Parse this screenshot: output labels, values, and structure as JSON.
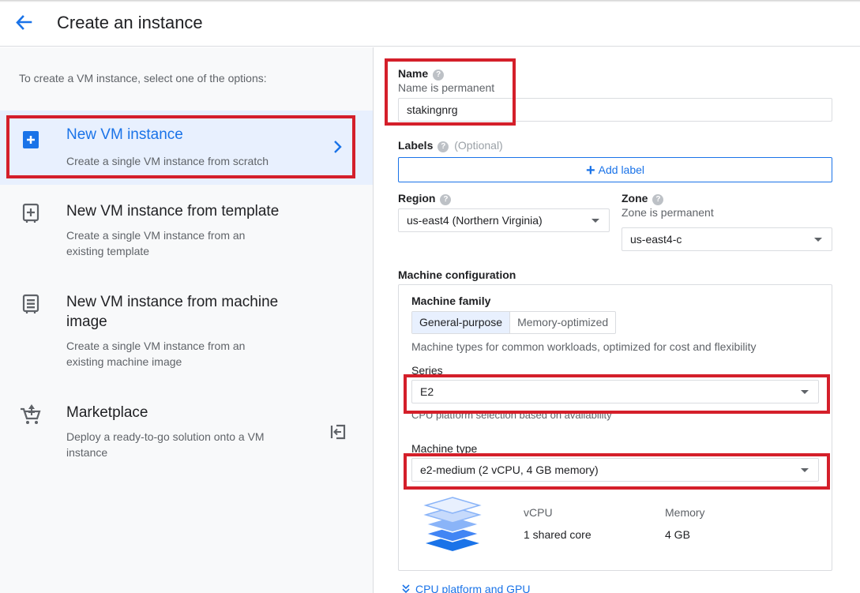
{
  "header": {
    "title": "Create an instance"
  },
  "left": {
    "intro": "To create a VM instance, select one of the options:",
    "options": [
      {
        "title": "New VM instance",
        "desc": "Create a single VM instance from scratch"
      },
      {
        "title": "New VM instance from template",
        "desc": "Create a single VM instance from an existing template"
      },
      {
        "title": "New VM instance from machine image",
        "desc": "Create a single VM instance from an existing machine image"
      },
      {
        "title": "Marketplace",
        "desc": "Deploy a ready-to-go solution onto a VM instance"
      }
    ]
  },
  "form": {
    "name_label": "Name",
    "name_hint": "Name is permanent",
    "name_value": "stakingnrg",
    "labels_label": "Labels",
    "labels_optional": "(Optional)",
    "add_label": "Add label",
    "region_label": "Region",
    "region_value": "us-east4 (Northern Virginia)",
    "zone_label": "Zone",
    "zone_hint": "Zone is permanent",
    "zone_value": "us-east4-c",
    "machine_config_label": "Machine configuration",
    "machine_family_label": "Machine family",
    "family_tabs": [
      "General-purpose",
      "Memory-optimized"
    ],
    "family_desc": "Machine types for common workloads, optimized for cost and flexibility",
    "series_label": "Series",
    "series_value": "E2",
    "series_hint": "CPU platform selection based on availability",
    "machine_type_label": "Machine type",
    "machine_type_value": "e2-medium (2 vCPU, 4 GB memory)",
    "vcpu_label": "vCPU",
    "vcpu_value": "1 shared core",
    "memory_label": "Memory",
    "memory_value": "4 GB",
    "cpu_platform_link": "CPU platform and GPU"
  },
  "colors": {
    "accent": "#1a73e8",
    "highlight": "#d41f2a"
  },
  "icons": [
    "back-arrow-icon",
    "add-box-icon",
    "template-icon",
    "machine-image-icon",
    "cart-icon",
    "chevron-right-icon",
    "exit-icon",
    "help-icon",
    "plus-icon",
    "dropdown-caret-icon",
    "stack-icon",
    "double-chevron-down-icon"
  ]
}
